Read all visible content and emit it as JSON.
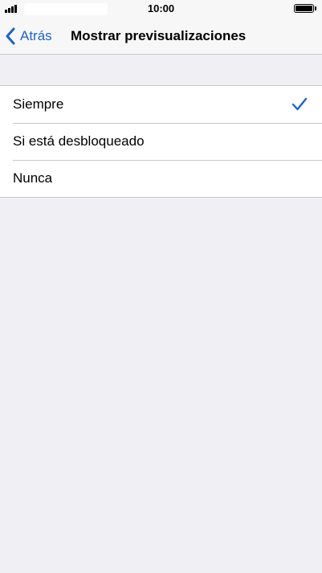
{
  "status_bar": {
    "time": "10:00"
  },
  "nav_bar": {
    "back_label": "Atrás",
    "title": "Mostrar previsualizaciones"
  },
  "options": [
    {
      "label": "Siempre",
      "selected": true
    },
    {
      "label": "Si está desbloqueado",
      "selected": false
    },
    {
      "label": "Nunca",
      "selected": false
    }
  ],
  "colors": {
    "accent": "#1a64c8",
    "background": "#efeff4",
    "separator": "#c8c7cc"
  },
  "icons": {
    "back": "chevron-left-icon",
    "selected": "checkmark-icon"
  }
}
